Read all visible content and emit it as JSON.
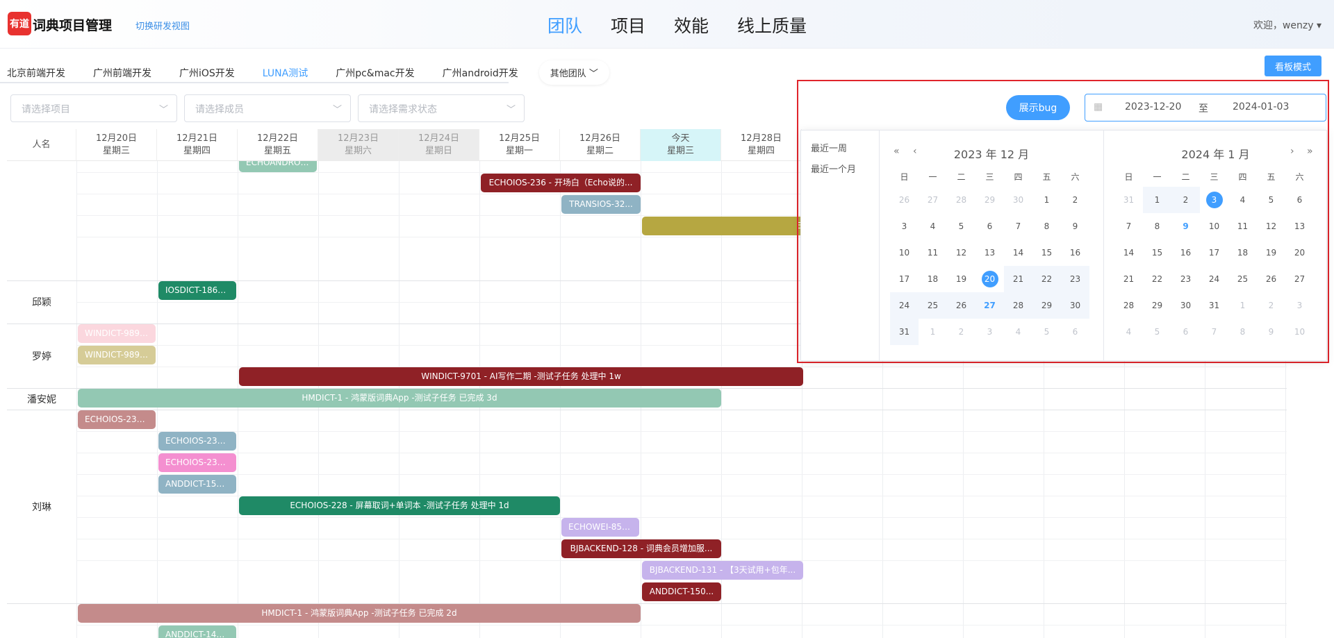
{
  "header": {
    "logo_text": "有道",
    "app_title": "词典项目管理",
    "switch_view": "切换研发视图",
    "nav": [
      "团队",
      "项目",
      "效能",
      "线上质量"
    ],
    "welcome": "欢迎，wenzy"
  },
  "teams": {
    "items": [
      "北京前端开发",
      "广州前端开发",
      "广州iOS开发",
      "LUNA测试",
      "广州pc&mac开发",
      "广州android开发"
    ],
    "active_index": 3,
    "other": "其他团队",
    "board_button": "看板模式"
  },
  "filters": {
    "project_placeholder": "请选择项目",
    "member_placeholder": "请选择成员",
    "status_placeholder": "请选择需求状态"
  },
  "schedule": {
    "name_header": "人名",
    "days": [
      {
        "date": "12月20日",
        "weekday": "星期三"
      },
      {
        "date": "12月21日",
        "weekday": "星期四"
      },
      {
        "date": "12月22日",
        "weekday": "星期五"
      },
      {
        "date": "12月23日",
        "weekday": "星期六"
      },
      {
        "date": "12月24日",
        "weekday": "星期日"
      },
      {
        "date": "12月25日",
        "weekday": "星期一"
      },
      {
        "date": "12月26日",
        "weekday": "星期二"
      },
      {
        "date": "今天",
        "weekday": "星期三"
      },
      {
        "date": "12月28日",
        "weekday": "星期四"
      }
    ],
    "people": [
      "邱颖",
      "罗婷",
      "潘安妮",
      "刘琳"
    ],
    "tasks": [
      {
        "label": "ECHOANDROI...",
        "color": "#93c8b3"
      },
      {
        "label": "ECHOIOS-236 - 开场白（Echo说的...",
        "color": "#8f2126"
      },
      {
        "label": "TRANSIOS-32...",
        "color": "#8fb3c4"
      },
      {
        "label": "E",
        "color": "#b6a741"
      },
      {
        "label": "IOSDICT-1862...",
        "color": "#1f8a66"
      },
      {
        "label": "WINDICT-9892...",
        "color": "#fbd7de"
      },
      {
        "label": "WINDICT-9892...",
        "color": "#d6cc97"
      },
      {
        "label": "WINDICT-9701 - AI写作二期 -测试子任务 处理中 1w",
        "color": "#8f2126"
      },
      {
        "label": "HMDICT-1 - 鸿蒙版词典App -测试子任务 已完成 3d",
        "color": "#93c8b3"
      },
      {
        "label": "ECHOIOS-235 ...",
        "color": "#c48b8b"
      },
      {
        "label": "ECHOIOS-239 ...",
        "color": "#8fb3c4"
      },
      {
        "label": "ECHOIOS-239 ...",
        "color": "#f48fd0"
      },
      {
        "label": "ANDDICT-150...",
        "color": "#8fb3c4"
      },
      {
        "label": "ECHOIOS-228 - 屏幕取词+单词本 -测试子任务 处理中 1d",
        "color": "#1f8a66"
      },
      {
        "label": "ECHOWEI-85 -...",
        "color": "#c6b3ec"
      },
      {
        "label": "BJBACKEND-128 - 词典会员增加服...",
        "color": "#8f2126"
      },
      {
        "label": "BJBACKEND-131 - 【3天试用+包年...",
        "color": "#c6b3ec"
      },
      {
        "label": "ANDDICT-150...",
        "color": "#8f2126"
      },
      {
        "label": "HMDICT-1 - 鸿蒙版词典App -测试子任务 已完成 2d",
        "color": "#c48b8b"
      },
      {
        "label": "ANDDICT-149...",
        "color": "#93c8b3"
      }
    ]
  },
  "range": {
    "show_bug": "展示bug",
    "start": "2023-12-20",
    "separator": "至",
    "end": "2024-01-03"
  },
  "picker": {
    "shortcuts": [
      "最近一周",
      "最近一个月"
    ],
    "left_title": "2023 年 12 月",
    "right_title": "2024 年 1 月",
    "weekdays": [
      "日",
      "一",
      "二",
      "三",
      "四",
      "五",
      "六"
    ],
    "left_days": [
      [
        "26",
        "27",
        "28",
        "29",
        "30",
        "1",
        "2"
      ],
      [
        "3",
        "4",
        "5",
        "6",
        "7",
        "8",
        "9"
      ],
      [
        "10",
        "11",
        "12",
        "13",
        "14",
        "15",
        "16"
      ],
      [
        "17",
        "18",
        "19",
        "20",
        "21",
        "22",
        "23"
      ],
      [
        "24",
        "25",
        "26",
        "27",
        "28",
        "29",
        "30"
      ],
      [
        "31",
        "1",
        "2",
        "3",
        "4",
        "5",
        "6"
      ]
    ],
    "right_days": [
      [
        "31",
        "1",
        "2",
        "3",
        "4",
        "5",
        "6"
      ],
      [
        "7",
        "8",
        "9",
        "10",
        "11",
        "12",
        "13"
      ],
      [
        "14",
        "15",
        "16",
        "17",
        "18",
        "19",
        "20"
      ],
      [
        "21",
        "22",
        "23",
        "24",
        "25",
        "26",
        "27"
      ],
      [
        "28",
        "29",
        "30",
        "31",
        "1",
        "2",
        "3"
      ],
      [
        "4",
        "5",
        "6",
        "7",
        "8",
        "9",
        "10"
      ]
    ]
  }
}
